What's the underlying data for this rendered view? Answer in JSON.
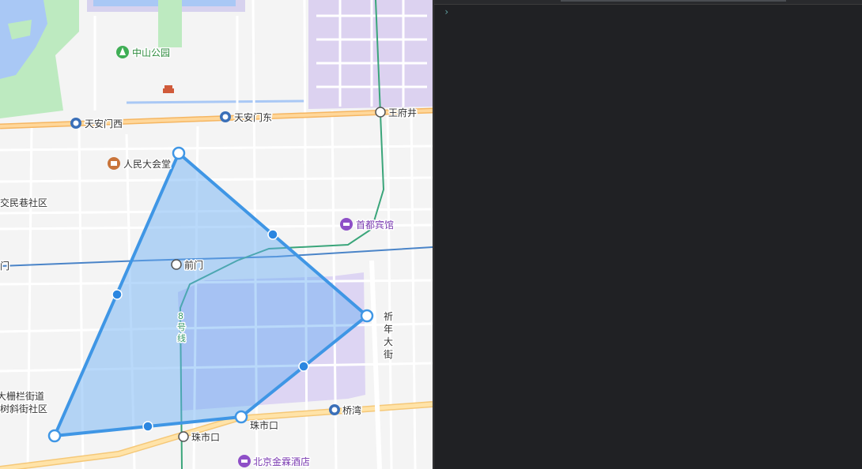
{
  "map": {
    "places": {
      "zhongshan_park": "中山公园",
      "tiananmen_west": "天安门西",
      "tiananmen_east": "天安门东",
      "wangfujing": "王府井",
      "great_hall": "人民大会堂",
      "jiaominxiang": "交民巷社区",
      "capital_hotel": "首都宾馆",
      "qianmen_partial": "门",
      "qianmen": "前门",
      "line8_chars": [
        "8",
        "号",
        "线"
      ],
      "qinian_chars": [
        "祈",
        "年",
        "大",
        "街"
      ],
      "dashilan_partial": "大栅栏街道",
      "shuxiejie_partial": "树斜街社区",
      "zhushikou_road": "珠市口",
      "zhushikou_station": "珠市口",
      "qiaowan": "桥湾",
      "jinglun_hotel": "北京金霖酒店"
    },
    "icons": {
      "metro": "metro-station-icon",
      "transfer": "transfer-station-icon",
      "park": "park-pin-icon",
      "landmark": "landmark-pin-icon",
      "hotel": "hotel-pin-icon"
    }
  },
  "console": {
    "prompt": "›"
  }
}
